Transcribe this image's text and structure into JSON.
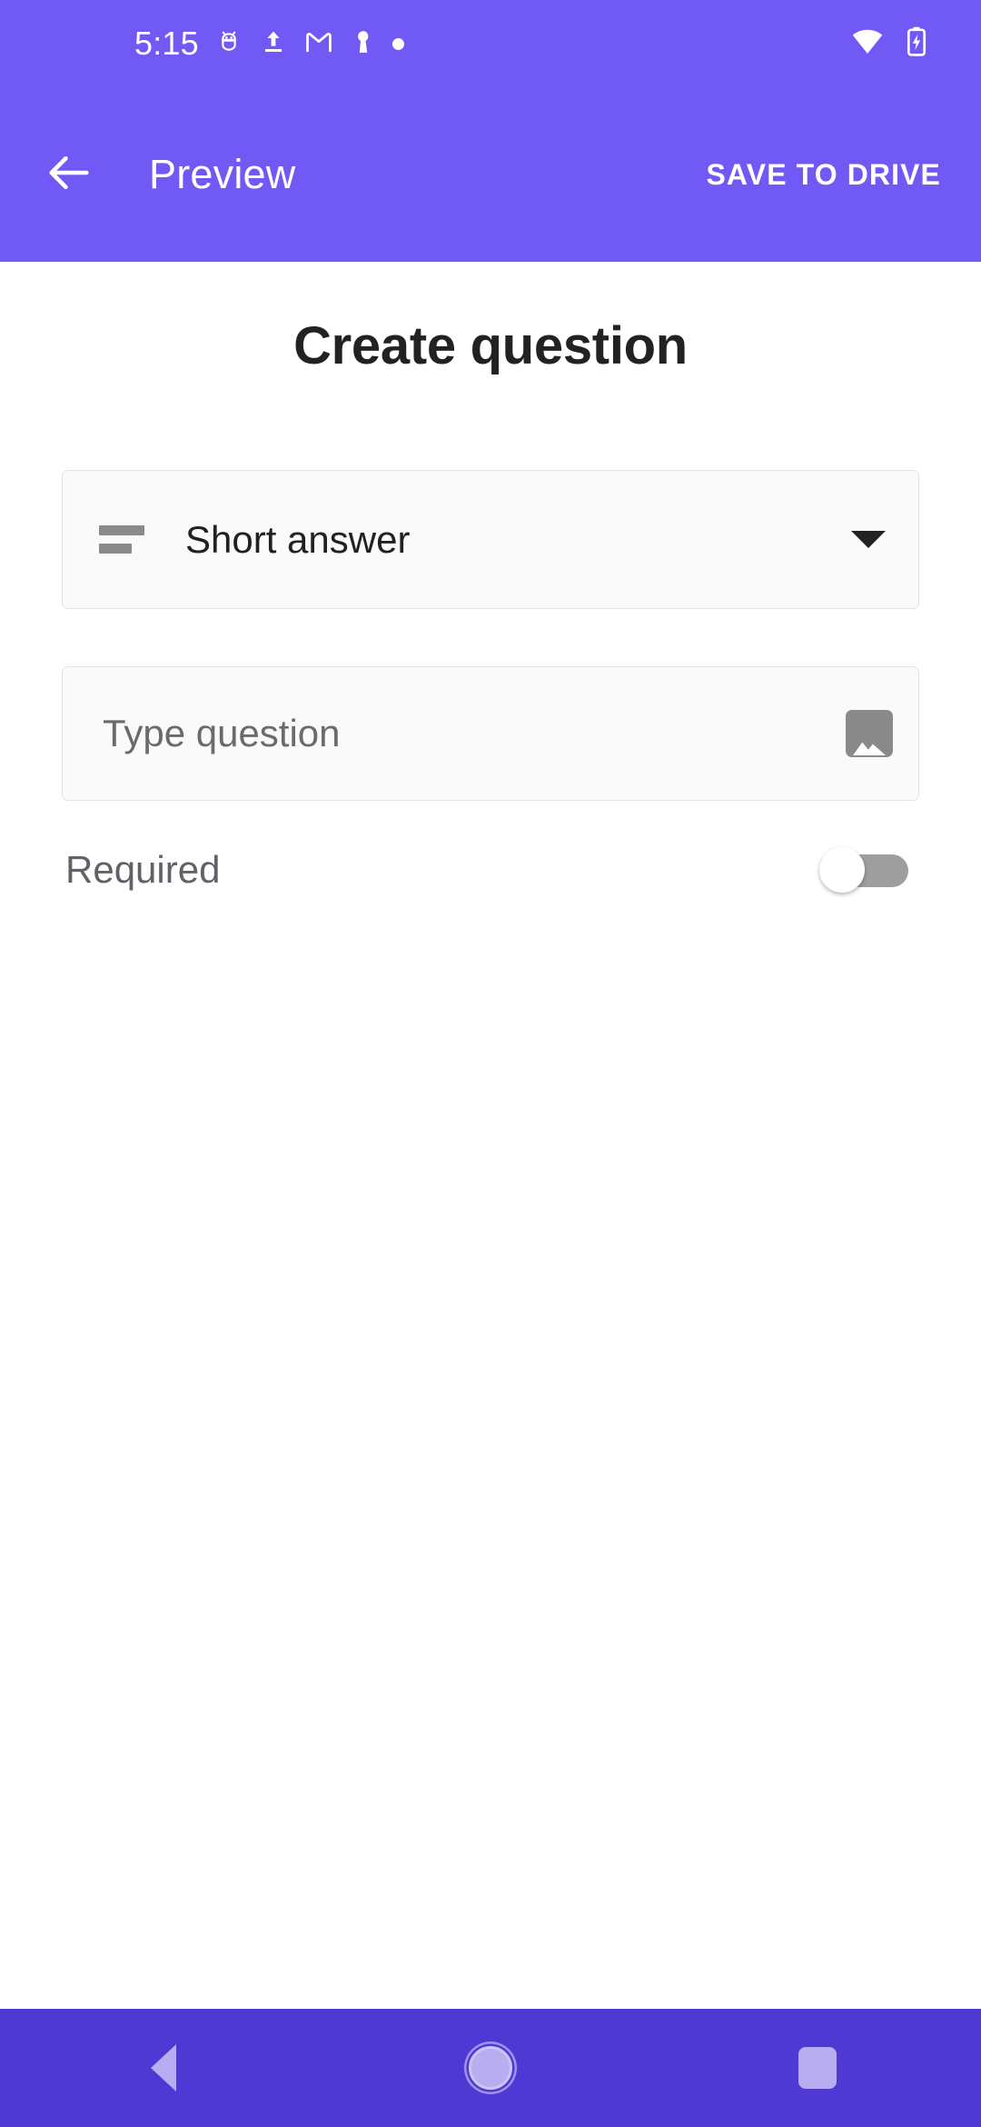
{
  "status_bar": {
    "clock": "5:15",
    "left_icons": [
      "android-debug-icon",
      "upload-icon",
      "gmail-icon",
      "vpn-key-icon",
      "notification-dot-icon"
    ],
    "right_icons": [
      "wifi-icon",
      "battery-charging-icon"
    ]
  },
  "app_bar": {
    "back_icon": "arrow-back-icon",
    "title": "Preview",
    "action_label": "SAVE TO DRIVE"
  },
  "content": {
    "page_title": "Create question",
    "question_type": {
      "icon": "short-answer-icon",
      "selected": "Short answer",
      "caret": "chevron-down-icon"
    },
    "question_input": {
      "placeholder": "Type question",
      "value": "",
      "image_button_icon": "insert-image-icon"
    },
    "required": {
      "label": "Required",
      "state": "off"
    }
  },
  "nav_bar": {
    "back": "nav-back-icon",
    "home": "nav-home-icon",
    "recents": "nav-recents-icon"
  },
  "colors": {
    "app_bar": "#7159f5",
    "nav_bar": "#4f39d4",
    "field_bg": "#fafafa",
    "field_border": "#e4e4e4",
    "title_text": "#222222",
    "nav_icon": "#b7adf0"
  }
}
